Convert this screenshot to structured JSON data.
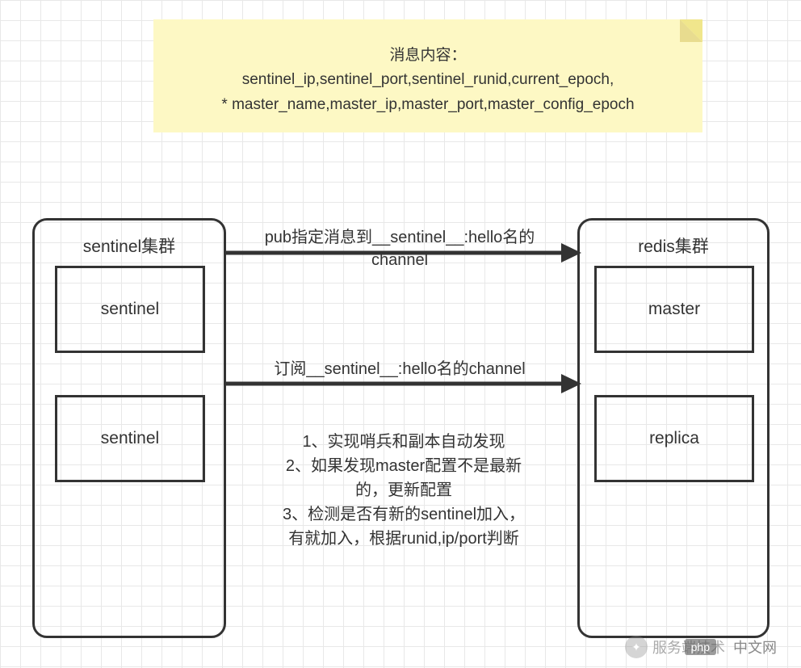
{
  "note": {
    "title": "消息内容：",
    "line1": "sentinel_ip,sentinel_port,sentinel_runid,current_epoch,",
    "line2": "* master_name,master_ip,master_port,master_config_epoch"
  },
  "left_cluster": {
    "title": "sentinel集群",
    "node1": "sentinel",
    "node2": "sentinel"
  },
  "right_cluster": {
    "title": "redis集群",
    "node1": "master",
    "node2": "replica"
  },
  "arrows": {
    "arrow1_label": "pub指定消息到__sentinel__:hello名的channel",
    "arrow2_label": "订阅__sentinel__:hello名的channel"
  },
  "notes": {
    "item1": "1、实现哨兵和副本自动发现",
    "item2": "2、如果发现master配置不是最新的，更新配置",
    "item3": "3、检测是否有新的sentinel加入，有就加入，根据runid,ip/port判断"
  },
  "watermark": {
    "text": "服务端技术",
    "php": "php",
    "cn": "中文网"
  }
}
